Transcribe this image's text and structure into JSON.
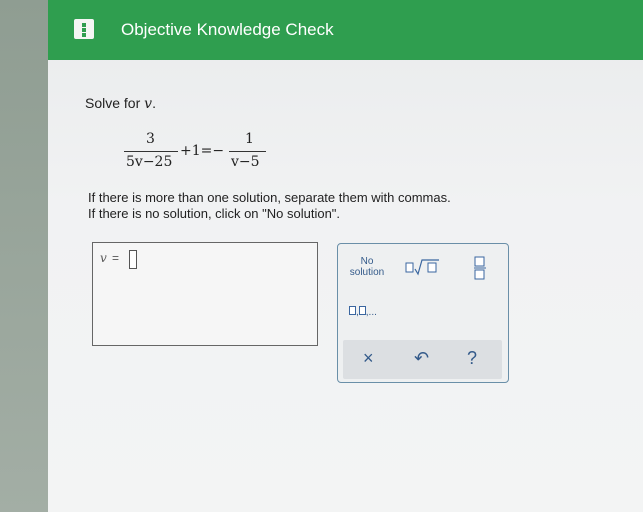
{
  "header": {
    "title": "Objective Knowledge Check",
    "menu_icon": "hamburger-menu-icon",
    "color": "#2f9e4f"
  },
  "problem": {
    "prompt_prefix": "Solve for ",
    "prompt_variable": "v",
    "prompt_suffix": ".",
    "equation": {
      "left_numerator": "3",
      "left_denominator": "5v−25",
      "middle": "+1=−",
      "right_numerator": "1",
      "right_denominator": "v−5"
    },
    "instruction_1": "If there is more than one solution, separate them with commas.",
    "instruction_2": "If there is no solution, click on \"No solution\"."
  },
  "answer": {
    "variable": "v",
    "equals": "=",
    "value": ""
  },
  "keypad": {
    "no_solution_line1": "No",
    "no_solution_line2": "solution",
    "list_suffix": ",...",
    "clear_symbol": "×",
    "undo_symbol": "↶",
    "help_symbol": "?"
  }
}
